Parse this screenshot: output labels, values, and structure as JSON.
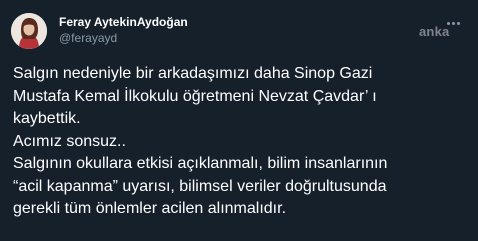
{
  "tweet": {
    "author_name": "Feray AytekinAydoğan",
    "author_handle": "@ferayayd",
    "watermark": "anka",
    "lines": [
      "Salgın nedeniyle bir arkadaşımızı daha Sinop Gazi",
      "Mustafa Kemal İlkokulu öğretmeni Nevzat Çavdar’ ı",
      "kaybettik.",
      "Acımız sonsuz..",
      "Salgının okullara etkisi açıklanmalı, bilim insanlarının",
      "“acil kapanma” uyarısı, bilimsel veriler doğrultusunda",
      "gerekli tüm önlemler acilen alınmalıdır."
    ]
  },
  "colors": {
    "background": "#15202b",
    "text": "#ffffff",
    "secondary_text": "#8899a6"
  },
  "icons": {
    "avatar": "avatar-photo",
    "more": "more-options-icon"
  }
}
